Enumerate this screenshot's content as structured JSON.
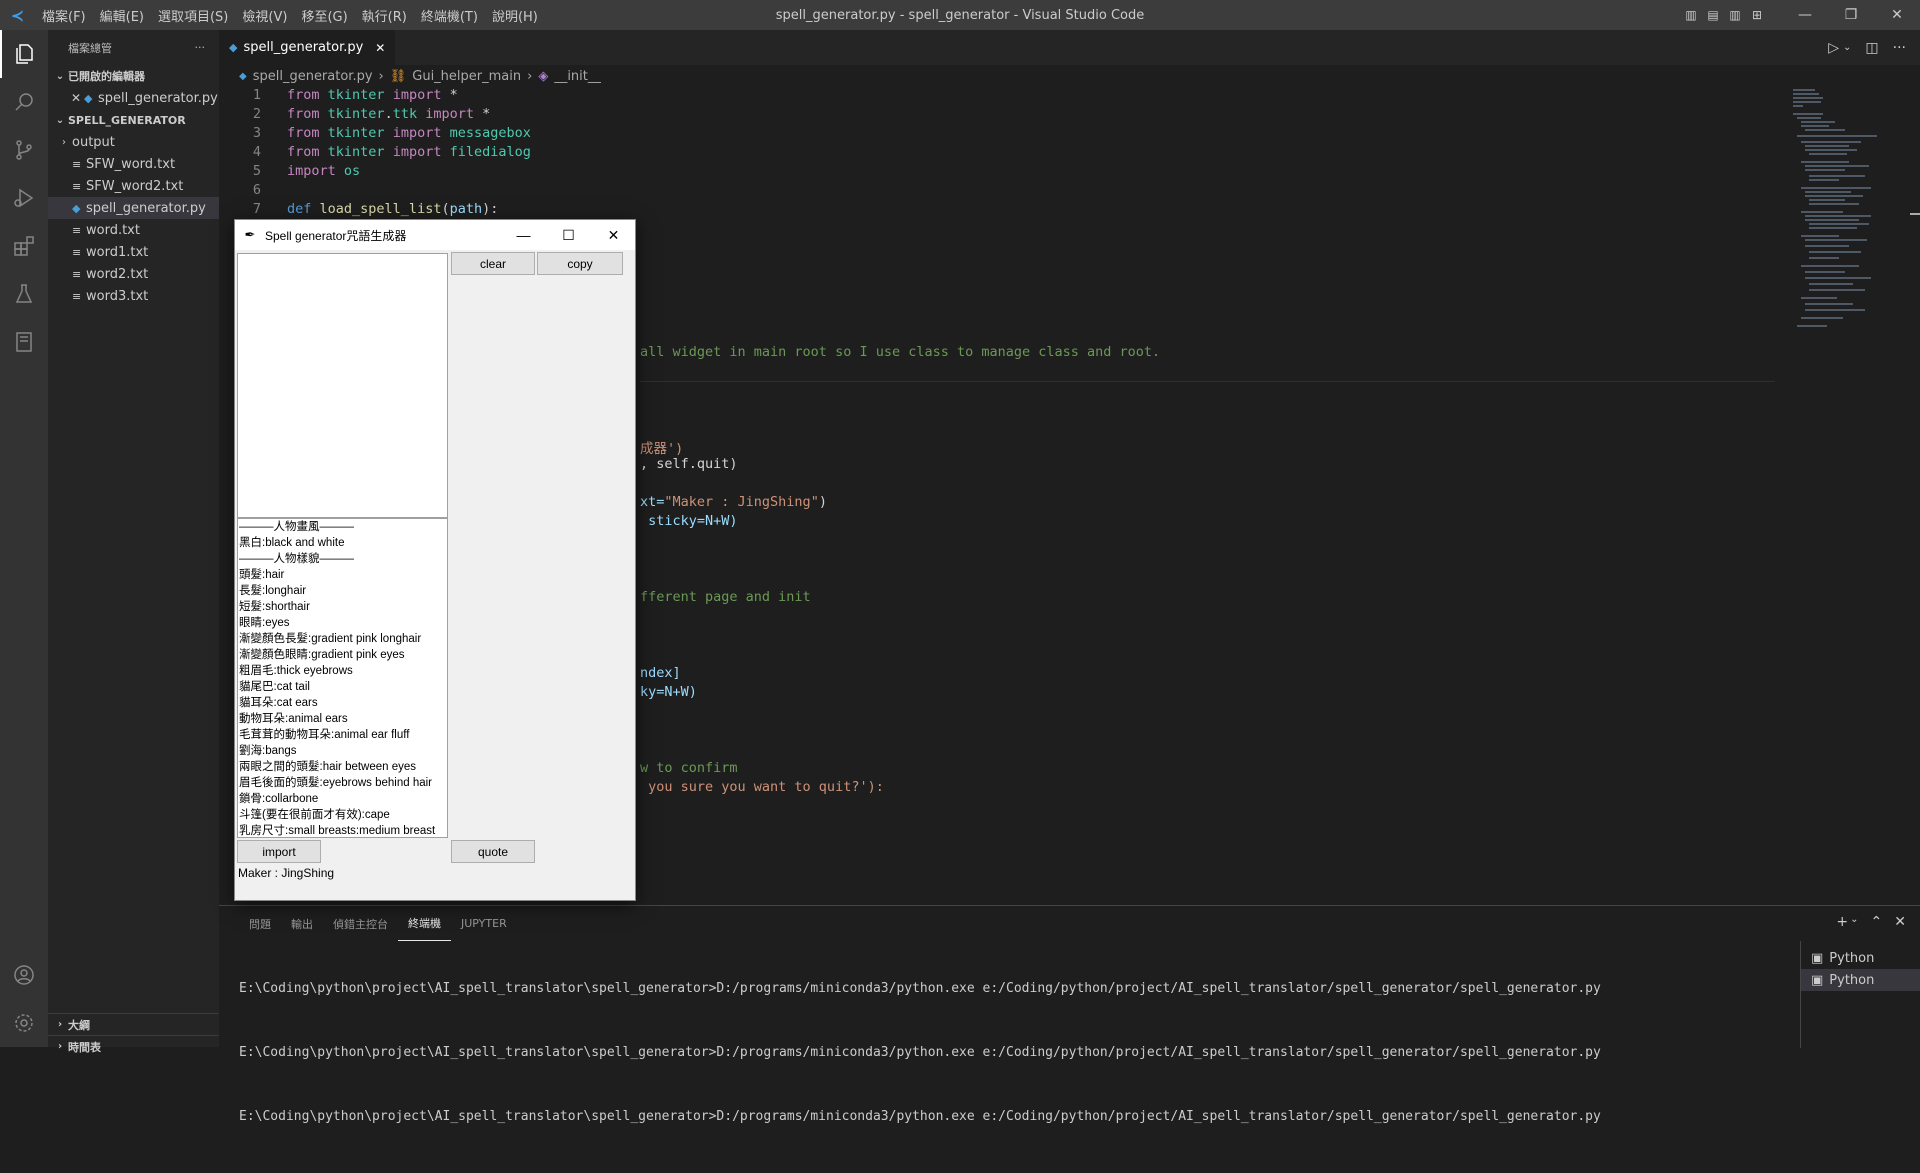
{
  "titlebar": {
    "menu": [
      "檔案(F)",
      "編輯(E)",
      "選取項目(S)",
      "檢視(V)",
      "移至(G)",
      "執行(R)",
      "終端機(T)",
      "說明(H)"
    ],
    "title": "spell_generator.py - spell_generator - Visual Studio Code"
  },
  "sidebar": {
    "header": "檔案總管",
    "open_editors": "已開啟的編輯器",
    "open_file": "spell_generator.py",
    "folder": "SPELL_GENERATOR",
    "items": [
      "output",
      "SFW_word.txt",
      "SFW_word2.txt",
      "spell_generator.py",
      "word.txt",
      "word1.txt",
      "word2.txt",
      "word3.txt"
    ],
    "outline": "大綱",
    "timeline": "時間表"
  },
  "editor": {
    "tab": "spell_generator.py",
    "breadcrumb": [
      "spell_generator.py",
      "Gui_helper_main",
      "__init__"
    ]
  },
  "code_lines": [
    "from tkinter import *",
    "from tkinter.ttk import *",
    "from tkinter import messagebox",
    "from tkinter import filedialog",
    "import os",
    "",
    "def load_spell_list(path):"
  ],
  "code_fragments": {
    "l1": "all widget in main root so I use class to manage class and root.",
    "l2": "成器')",
    "l3": ", self.quit)",
    "l4a": "xt=",
    "l4b": "\"Maker : JingShing\"",
    "l4c": ")",
    "l5": " sticky=N+W)",
    "l6": "fferent page and init",
    "l7": "ndex]",
    "l8": "ky=N+W)",
    "l9": "w to confirm",
    "l10": " you sure you want to quit?'):"
  },
  "panel": {
    "tabs": [
      "問題",
      "輸出",
      "偵錯主控台",
      "終端機",
      "JUPYTER"
    ],
    "terminal_lines": [
      "E:\\Coding\\python\\project\\AI_spell_translator\\spell_generator>D:/programs/miniconda3/python.exe e:/Coding/python/project/AI_spell_translator/spell_generator/spell_generator.py",
      "E:\\Coding\\python\\project\\AI_spell_translator\\spell_generator>D:/programs/miniconda3/python.exe e:/Coding/python/project/AI_spell_translator/spell_generator/spell_generator.py",
      "E:\\Coding\\python\\project\\AI_spell_translator\\spell_generator>D:/programs/miniconda3/python.exe e:/Coding/python/project/AI_spell_translator/spell_generator/spell_generator.py"
    ],
    "terminals": [
      "Python",
      "Python"
    ]
  },
  "tkapp": {
    "title": "Spell generator咒語生成器",
    "clear": "clear",
    "copy": "copy",
    "import": "import",
    "quote": "quote",
    "maker": "Maker : JingShing",
    "list": [
      "———人物畫風———",
      "黑白:black and white",
      "———人物樣貌———",
      "頭髮:hair",
      "長髮:longhair",
      "短髮:shorthair",
      "眼睛:eyes",
      "漸變顏色長髮:gradient pink longhair",
      "漸變顏色眼睛:gradient pink eyes",
      "粗眉毛:thick eyebrows",
      "貓尾巴:cat tail",
      "貓耳朵:cat ears",
      "動物耳朵:animal ears",
      "毛茸茸的動物耳朵:animal ear fluff",
      "劉海:bangs",
      "兩眼之間的頭髮:hair between eyes",
      "眉毛後面的頭髮:eyebrows behind hair",
      "鎖骨:collarbone",
      "斗篷(要在很前面才有效):cape",
      "乳房尺寸:small breasts:medium breast"
    ]
  }
}
